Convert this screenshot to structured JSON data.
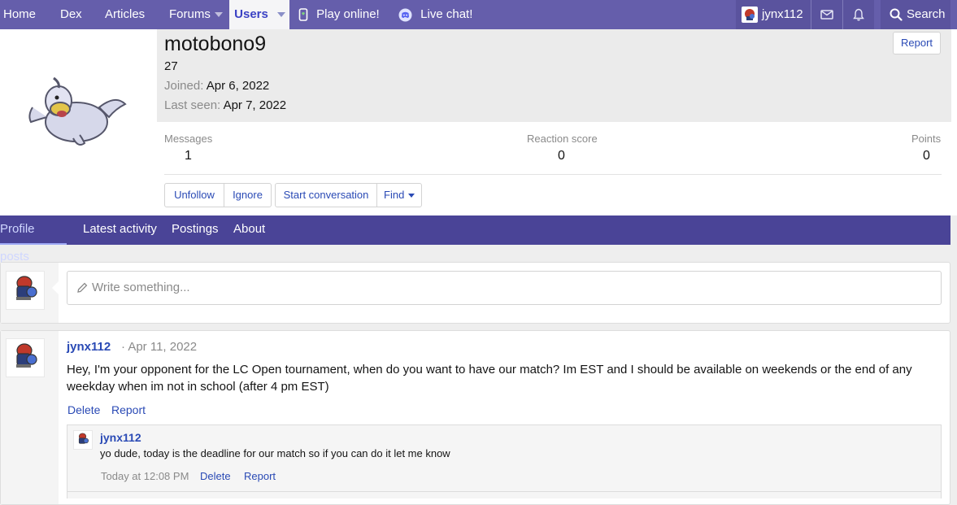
{
  "nav": {
    "home": "Home",
    "dex": "Dex",
    "articles": "Articles",
    "forums": "Forums",
    "users": "Users",
    "play_online": "Play online!",
    "live_chat": "Live chat!",
    "current_user": "jynx112",
    "search": "Search"
  },
  "profile": {
    "username": "motobono9",
    "age": "27",
    "joined_label": "Joined:",
    "joined_value": "Apr 6, 2022",
    "last_seen_label": "Last seen:",
    "last_seen_value": "Apr 7, 2022",
    "report": "Report",
    "stats": {
      "messages_label": "Messages",
      "messages_value": "1",
      "reaction_label": "Reaction score",
      "reaction_value": "0",
      "points_label": "Points",
      "points_value": "0"
    },
    "actions": {
      "unfollow": "Unfollow",
      "ignore": "Ignore",
      "start_conversation": "Start conversation",
      "find": "Find"
    }
  },
  "tabs": [
    "Profile posts",
    "Latest activity",
    "Postings",
    "About"
  ],
  "composer": {
    "placeholder": "Write something..."
  },
  "post": {
    "author": "jynx112",
    "date": "· Apr 11, 2022",
    "body": "Hey, I'm your opponent for the LC Open tournament, when do you want to have our match? Im EST and I should be available on weekends or the end of any weekday when im not in school (after 4 pm EST)",
    "delete": "Delete",
    "report": "Report",
    "comment": {
      "author": "jynx112",
      "text": "yo dude, today is the deadline for our match so if you can do it let me know",
      "time": "Today at 12:08 PM",
      "delete": "Delete",
      "report": "Report"
    }
  },
  "colors": {
    "nav_bg": "#655eab",
    "tabs_bg": "#4a4497",
    "link": "#2a4ab5"
  }
}
